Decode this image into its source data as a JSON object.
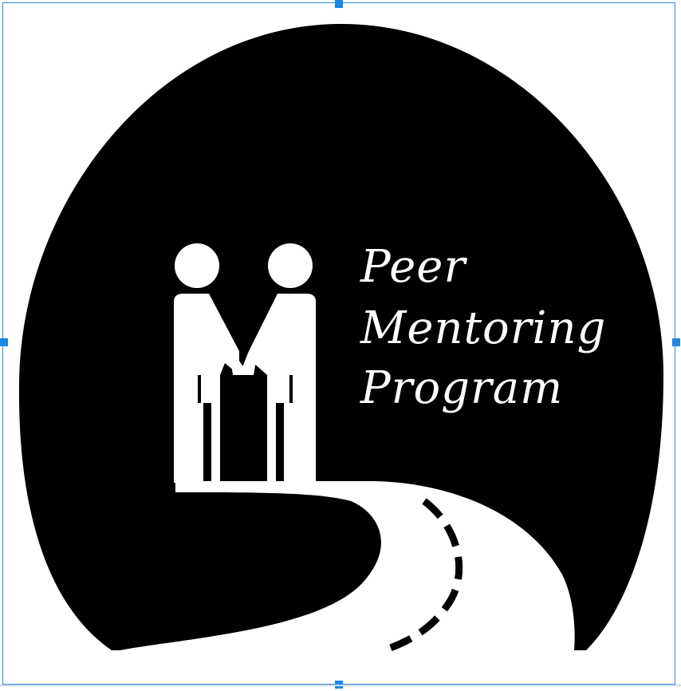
{
  "logo": {
    "line1": "Peer",
    "line2": "Mentoring",
    "line3": "Program"
  },
  "colors": {
    "background": "#ffffff",
    "badge": "#000000",
    "foreground": "#ffffff",
    "selection": "#1e88e5"
  },
  "icons": {
    "figures": "two-people-handshake-icon",
    "road": "road-icon"
  }
}
